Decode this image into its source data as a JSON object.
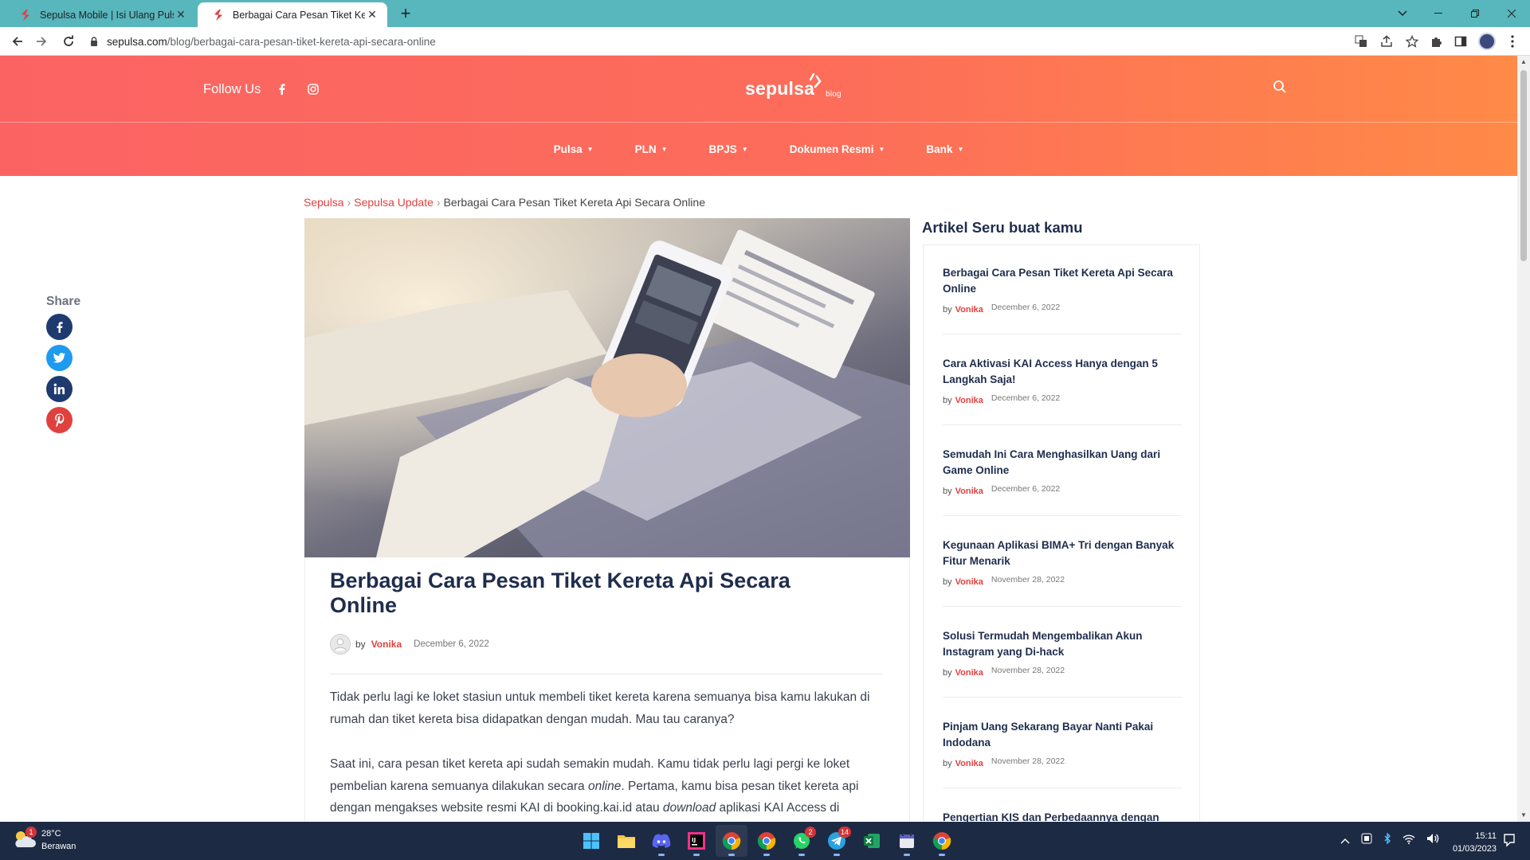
{
  "browser": {
    "tabs": [
      {
        "title": "Sepulsa Mobile | Isi Ulang Pulsa S",
        "active": false
      },
      {
        "title": "Berbagai Cara Pesan Tiket Kereta",
        "active": true
      }
    ],
    "url_host": "sepulsa.com",
    "url_path": "/blog/berbagai-cara-pesan-tiket-kereta-api-secara-online"
  },
  "header": {
    "follow_label": "Follow Us",
    "logo_text": "sepulsa",
    "logo_suffix": "blog",
    "nav": [
      {
        "label": "Pulsa"
      },
      {
        "label": "PLN"
      },
      {
        "label": "BPJS"
      },
      {
        "label": "Dokumen Resmi"
      },
      {
        "label": "Bank"
      }
    ],
    "gradient_start": "#fb6363",
    "gradient_end": "#ff8a47"
  },
  "share": {
    "label": "Share",
    "buttons": [
      {
        "name": "facebook",
        "color": "#1f3a6e"
      },
      {
        "name": "twitter",
        "color": "#1d9bf0"
      },
      {
        "name": "linkedin",
        "color": "#1f3a6e"
      },
      {
        "name": "pinterest",
        "color": "#e0413e"
      }
    ]
  },
  "breadcrumb": {
    "items": [
      "Sepulsa",
      "Sepulsa Update",
      "Berbagai Cara Pesan Tiket Kereta Api Secara Online"
    ],
    "separator": "›"
  },
  "article": {
    "title": "Berbagai Cara Pesan Tiket Kereta Api Secara Online",
    "by": "by",
    "author": "Vonika",
    "date": "December 6, 2022",
    "p1": "Tidak perlu lagi ke loket stasiun untuk membeli tiket kereta karena semuanya bisa kamu lakukan di rumah dan tiket kereta bisa didapatkan dengan mudah. Mau tau caranya?",
    "p2_a": "Saat ini, cara pesan tiket kereta api sudah semakin mudah. Kamu tidak perlu lagi pergi ke loket pembelian karena semuanya dilakukan secara ",
    "p2_em1": "online",
    "p2_b": ". Pertama, kamu bisa pesan tiket kereta api dengan mengakses website resmi KAI di booking.kai.id atau ",
    "p2_em2": "download",
    "p2_c": " aplikasi KAI Access di"
  },
  "aside": {
    "title": "Artikel Seru buat kamu",
    "items": [
      {
        "title": "Berbagai Cara Pesan Tiket Kereta Api Secara Online",
        "by": "by",
        "author": "Vonika",
        "date": "December 6, 2022"
      },
      {
        "title": "Cara Aktivasi KAI Access Hanya dengan 5 Langkah Saja!",
        "by": "by",
        "author": "Vonika",
        "date": "December 6, 2022"
      },
      {
        "title": "Semudah Ini Cara Menghasilkan Uang dari Game Online",
        "by": "by",
        "author": "Vonika",
        "date": "December 6, 2022"
      },
      {
        "title": "Kegunaan Aplikasi BIMA+ Tri dengan Banyak Fitur Menarik",
        "by": "by",
        "author": "Vonika",
        "date": "November 28, 2022"
      },
      {
        "title": "Solusi Termudah Mengembalikan Akun Instagram yang Di-hack",
        "by": "by",
        "author": "Vonika",
        "date": "November 28, 2022"
      },
      {
        "title": "Pinjam Uang Sekarang Bayar Nanti Pakai Indodana",
        "by": "by",
        "author": "Vonika",
        "date": "November 28, 2022"
      },
      {
        "title": "Pengertian KIS dan Perbedaannya dengan",
        "by": "",
        "author": "",
        "date": ""
      }
    ]
  },
  "taskbar": {
    "weather_temp": "28°C",
    "weather_desc": "Berawan",
    "weather_badge": "1",
    "apps": [
      {
        "name": "windows-start",
        "badge": ""
      },
      {
        "name": "file-explorer",
        "badge": ""
      },
      {
        "name": "discord",
        "badge": ""
      },
      {
        "name": "jetbrains-ide",
        "badge": ""
      },
      {
        "name": "chrome",
        "badge": ""
      },
      {
        "name": "chrome-profile-2",
        "badge": ""
      },
      {
        "name": "whatsapp",
        "badge": "2"
      },
      {
        "name": "telegram",
        "badge": "14"
      },
      {
        "name": "excel",
        "badge": ""
      },
      {
        "name": "calendar-app",
        "badge": ""
      },
      {
        "name": "chrome-profile-3",
        "badge": ""
      }
    ],
    "time": "15:11",
    "date": "01/03/2023"
  }
}
